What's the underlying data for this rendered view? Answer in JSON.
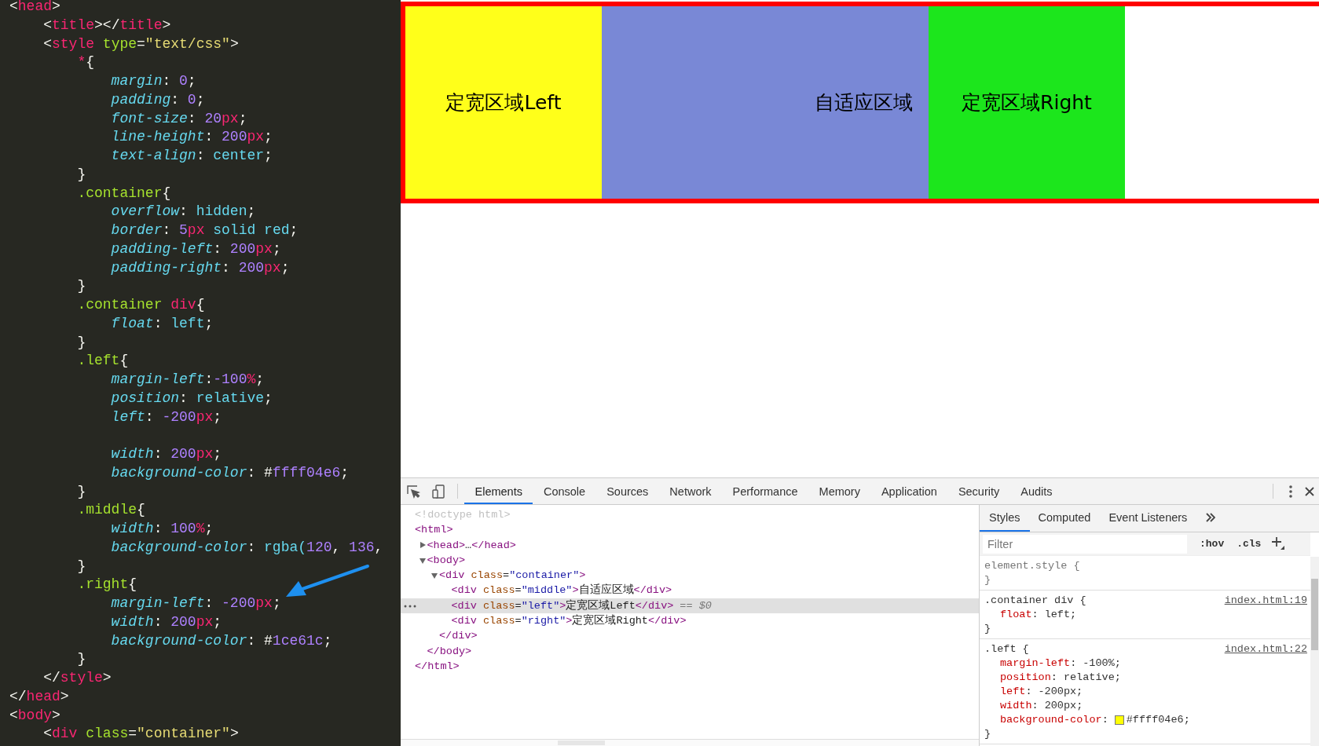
{
  "editor": {
    "lines": [
      {
        "tokens": [
          {
            "kind": "punct",
            "text": "<"
          },
          {
            "kind": "tag",
            "text": "head"
          },
          {
            "kind": "punct",
            "text": ">"
          }
        ]
      },
      {
        "tokens": [
          {
            "kind": "punct",
            "text": "    <"
          },
          {
            "kind": "tag",
            "text": "title"
          },
          {
            "kind": "punct",
            "text": "></"
          },
          {
            "kind": "tag",
            "text": "title"
          },
          {
            "kind": "punct",
            "text": ">"
          }
        ]
      },
      {
        "tokens": [
          {
            "kind": "punct",
            "text": "    <"
          },
          {
            "kind": "tag",
            "text": "style"
          },
          {
            "kind": "attr",
            "text": " type"
          },
          {
            "kind": "punct",
            "text": "="
          },
          {
            "kind": "string",
            "text": "\"text/css\""
          },
          {
            "kind": "punct",
            "text": ">"
          }
        ]
      },
      {
        "tokens": [
          {
            "kind": "tag",
            "text": "        *"
          },
          {
            "kind": "punct",
            "text": "{"
          }
        ]
      },
      {
        "tokens": [
          {
            "kind": "property",
            "text": "            margin"
          },
          {
            "kind": "punct",
            "text": ": "
          },
          {
            "kind": "number",
            "text": "0"
          },
          {
            "kind": "punct",
            "text": ";"
          }
        ]
      },
      {
        "tokens": [
          {
            "kind": "property",
            "text": "            padding"
          },
          {
            "kind": "punct",
            "text": ": "
          },
          {
            "kind": "number",
            "text": "0"
          },
          {
            "kind": "punct",
            "text": ";"
          }
        ]
      },
      {
        "tokens": [
          {
            "kind": "property",
            "text": "            font-size"
          },
          {
            "kind": "punct",
            "text": ": "
          },
          {
            "kind": "number",
            "text": "20"
          },
          {
            "kind": "unit",
            "text": "px"
          },
          {
            "kind": "punct",
            "text": ";"
          }
        ]
      },
      {
        "tokens": [
          {
            "kind": "property",
            "text": "            line-height"
          },
          {
            "kind": "punct",
            "text": ": "
          },
          {
            "kind": "number",
            "text": "200"
          },
          {
            "kind": "unit",
            "text": "px"
          },
          {
            "kind": "punct",
            "text": ";"
          }
        ]
      },
      {
        "tokens": [
          {
            "kind": "property",
            "text": "            text-align"
          },
          {
            "kind": "punct",
            "text": ": "
          },
          {
            "kind": "value",
            "text": "center"
          },
          {
            "kind": "punct",
            "text": ";"
          }
        ]
      },
      {
        "tokens": [
          {
            "kind": "punct",
            "text": "        }"
          }
        ]
      },
      {
        "tokens": [
          {
            "kind": "selector",
            "text": "        .container"
          },
          {
            "kind": "punct",
            "text": "{"
          }
        ]
      },
      {
        "tokens": [
          {
            "kind": "property",
            "text": "            overflow"
          },
          {
            "kind": "punct",
            "text": ": "
          },
          {
            "kind": "value",
            "text": "hidden"
          },
          {
            "kind": "punct",
            "text": ";"
          }
        ]
      },
      {
        "tokens": [
          {
            "kind": "property",
            "text": "            border"
          },
          {
            "kind": "punct",
            "text": ": "
          },
          {
            "kind": "number",
            "text": "5"
          },
          {
            "kind": "unit",
            "text": "px"
          },
          {
            "kind": "value",
            "text": " solid red"
          },
          {
            "kind": "punct",
            "text": ";"
          }
        ]
      },
      {
        "tokens": [
          {
            "kind": "property",
            "text": "            padding-left"
          },
          {
            "kind": "punct",
            "text": ": "
          },
          {
            "kind": "number",
            "text": "200"
          },
          {
            "kind": "unit",
            "text": "px"
          },
          {
            "kind": "punct",
            "text": ";"
          }
        ]
      },
      {
        "tokens": [
          {
            "kind": "property",
            "text": "            padding-right"
          },
          {
            "kind": "punct",
            "text": ": "
          },
          {
            "kind": "number",
            "text": "200"
          },
          {
            "kind": "unit",
            "text": "px"
          },
          {
            "kind": "punct",
            "text": ";"
          }
        ]
      },
      {
        "tokens": [
          {
            "kind": "punct",
            "text": "        }"
          }
        ]
      },
      {
        "tokens": [
          {
            "kind": "selector",
            "text": "        .container"
          },
          {
            "kind": "tag",
            "text": " div"
          },
          {
            "kind": "punct",
            "text": "{"
          }
        ]
      },
      {
        "tokens": [
          {
            "kind": "property",
            "text": "            float"
          },
          {
            "kind": "punct",
            "text": ": "
          },
          {
            "kind": "value",
            "text": "left"
          },
          {
            "kind": "punct",
            "text": ";"
          }
        ]
      },
      {
        "tokens": [
          {
            "kind": "punct",
            "text": "        }"
          }
        ]
      },
      {
        "tokens": [
          {
            "kind": "selector",
            "text": "        .left"
          },
          {
            "kind": "punct",
            "text": "{"
          }
        ]
      },
      {
        "tokens": [
          {
            "kind": "property",
            "text": "            margin-left"
          },
          {
            "kind": "punct",
            "text": ":"
          },
          {
            "kind": "number",
            "text": "-100"
          },
          {
            "kind": "unit",
            "text": "%"
          },
          {
            "kind": "punct",
            "text": ";"
          }
        ]
      },
      {
        "tokens": [
          {
            "kind": "property",
            "text": "            position"
          },
          {
            "kind": "punct",
            "text": ": "
          },
          {
            "kind": "value",
            "text": "relative"
          },
          {
            "kind": "punct",
            "text": ";"
          }
        ]
      },
      {
        "tokens": [
          {
            "kind": "property",
            "text": "            left"
          },
          {
            "kind": "punct",
            "text": ": "
          },
          {
            "kind": "number",
            "text": "-200"
          },
          {
            "kind": "unit",
            "text": "px"
          },
          {
            "kind": "punct",
            "text": ";"
          }
        ],
        "blank_line_after": true
      },
      {
        "tokens": [
          {
            "kind": "property",
            "text": "            width"
          },
          {
            "kind": "punct",
            "text": ": "
          },
          {
            "kind": "number",
            "text": "200"
          },
          {
            "kind": "unit",
            "text": "px"
          },
          {
            "kind": "punct",
            "text": ";"
          }
        ]
      },
      {
        "tokens": [
          {
            "kind": "property",
            "text": "            background-color"
          },
          {
            "kind": "punct",
            "text": ": #"
          },
          {
            "kind": "number",
            "text": "ffff04e6"
          },
          {
            "kind": "punct",
            "text": ";"
          }
        ]
      },
      {
        "tokens": [
          {
            "kind": "punct",
            "text": "        }"
          }
        ]
      },
      {
        "tokens": [
          {
            "kind": "selector",
            "text": "        .middle"
          },
          {
            "kind": "punct",
            "text": "{"
          }
        ]
      },
      {
        "tokens": [
          {
            "kind": "property",
            "text": "            width"
          },
          {
            "kind": "punct",
            "text": ": "
          },
          {
            "kind": "number",
            "text": "100"
          },
          {
            "kind": "unit",
            "text": "%"
          },
          {
            "kind": "punct",
            "text": ";"
          }
        ]
      },
      {
        "tokens": [
          {
            "kind": "property",
            "text": "            background-color"
          },
          {
            "kind": "punct",
            "text": ": "
          },
          {
            "kind": "value",
            "text": "rgba("
          },
          {
            "kind": "number",
            "text": "120"
          },
          {
            "kind": "punct",
            "text": ", "
          },
          {
            "kind": "number",
            "text": "136"
          },
          {
            "kind": "punct",
            "text": ","
          }
        ]
      },
      {
        "tokens": [
          {
            "kind": "punct",
            "text": "        }"
          }
        ]
      },
      {
        "tokens": [
          {
            "kind": "selector",
            "text": "        .right"
          },
          {
            "kind": "punct",
            "text": "{"
          }
        ]
      },
      {
        "tokens": [
          {
            "kind": "property",
            "text": "            margin-left"
          },
          {
            "kind": "punct",
            "text": ": "
          },
          {
            "kind": "number",
            "text": "-200"
          },
          {
            "kind": "unit",
            "text": "px"
          },
          {
            "kind": "punct",
            "text": ";"
          }
        ]
      },
      {
        "tokens": [
          {
            "kind": "property",
            "text": "            width"
          },
          {
            "kind": "punct",
            "text": ": "
          },
          {
            "kind": "number",
            "text": "200"
          },
          {
            "kind": "unit",
            "text": "px"
          },
          {
            "kind": "punct",
            "text": ";"
          }
        ]
      },
      {
        "tokens": [
          {
            "kind": "property",
            "text": "            background-color"
          },
          {
            "kind": "punct",
            "text": ": #"
          },
          {
            "kind": "number",
            "text": "1ce61c"
          },
          {
            "kind": "punct",
            "text": ";"
          }
        ]
      },
      {
        "tokens": [
          {
            "kind": "punct",
            "text": "        }"
          }
        ]
      },
      {
        "tokens": [
          {
            "kind": "punct",
            "text": "    </"
          },
          {
            "kind": "tag",
            "text": "style"
          },
          {
            "kind": "punct",
            "text": ">"
          }
        ]
      },
      {
        "tokens": [
          {
            "kind": "punct",
            "text": "</"
          },
          {
            "kind": "tag",
            "text": "head"
          },
          {
            "kind": "punct",
            "text": ">"
          }
        ]
      },
      {
        "tokens": [
          {
            "kind": "punct",
            "text": "<"
          },
          {
            "kind": "tag",
            "text": "body"
          },
          {
            "kind": "punct",
            "text": ">"
          }
        ]
      },
      {
        "tokens": [
          {
            "kind": "punct",
            "text": "    <"
          },
          {
            "kind": "tag",
            "text": "div"
          },
          {
            "kind": "attr",
            "text": " class"
          },
          {
            "kind": "punct",
            "text": "="
          },
          {
            "kind": "string",
            "text": "\"container\""
          },
          {
            "kind": "punct",
            "text": ">"
          }
        ]
      }
    ]
  },
  "preview": {
    "blocks": [
      {
        "kind": "fixed",
        "text": "定宽区域Left",
        "color": "#ffff1a"
      },
      {
        "kind": "fluid",
        "text": "自适应区域",
        "color": "#7988d6"
      },
      {
        "kind": "fixed",
        "text": "定宽区域Right",
        "color": "#1ce61c"
      }
    ]
  },
  "devtools": {
    "tabs": [
      {
        "label": "Elements",
        "selected": true
      },
      {
        "label": "Console",
        "selected": false
      },
      {
        "label": "Sources",
        "selected": false
      },
      {
        "label": "Network",
        "selected": false
      },
      {
        "label": "Performance",
        "selected": false
      },
      {
        "label": "Memory",
        "selected": false
      },
      {
        "label": "Application",
        "selected": false
      },
      {
        "label": "Security",
        "selected": false
      },
      {
        "label": "Audits",
        "selected": false
      }
    ],
    "dom_tree": [
      {
        "tokens": [
          {
            "kind": "doctype",
            "text": "<!doctype html>"
          }
        ],
        "selected": false
      },
      {
        "tokens": [
          {
            "kind": "tag",
            "text": "<html>"
          }
        ],
        "selected": false,
        "children": [
          {
            "tokens": [
              {
                "kind": "tag",
                "text": "<head>"
              },
              {
                "kind": "text",
                "text": "…"
              },
              {
                "kind": "tag",
                "text": "</head>"
              }
            ],
            "expanded": false,
            "selected": false
          },
          {
            "tokens": [
              {
                "kind": "tag",
                "text": "<body>"
              }
            ],
            "expanded": true,
            "selected": false,
            "children": [
              {
                "tokens": [
                  {
                    "kind": "tag",
                    "text": "<div"
                  },
                  {
                    "kind": "attr",
                    "text": " class"
                  },
                  {
                    "kind": "text",
                    "text": "="
                  },
                  {
                    "kind": "val",
                    "text": "\"container\""
                  },
                  {
                    "kind": "tag",
                    "text": ">"
                  }
                ],
                "expanded": true,
                "selected": false,
                "children": [
                  {
                    "tokens": [
                      {
                        "kind": "tag",
                        "text": "<div"
                      },
                      {
                        "kind": "attr",
                        "text": " class"
                      },
                      {
                        "kind": "text",
                        "text": "="
                      },
                      {
                        "kind": "val",
                        "text": "\"middle\""
                      },
                      {
                        "kind": "tag",
                        "text": ">"
                      },
                      {
                        "kind": "text",
                        "text": "自适应区域"
                      },
                      {
                        "kind": "tag",
                        "text": "</div>"
                      }
                    ],
                    "selected": false
                  },
                  {
                    "tokens": [
                      {
                        "kind": "tag",
                        "text": "<div"
                      },
                      {
                        "kind": "attr",
                        "text": " class"
                      },
                      {
                        "kind": "text",
                        "text": "="
                      },
                      {
                        "kind": "val",
                        "text": "\"left\""
                      },
                      {
                        "kind": "tag",
                        "text": ">"
                      },
                      {
                        "kind": "text",
                        "text": "定宽区域Left"
                      },
                      {
                        "kind": "tag",
                        "text": "</div>"
                      }
                    ],
                    "selected": true,
                    "ref": "== $0"
                  },
                  {
                    "tokens": [
                      {
                        "kind": "tag",
                        "text": "<div"
                      },
                      {
                        "kind": "attr",
                        "text": " class"
                      },
                      {
                        "kind": "text",
                        "text": "="
                      },
                      {
                        "kind": "val",
                        "text": "\"right\""
                      },
                      {
                        "kind": "tag",
                        "text": ">"
                      },
                      {
                        "kind": "text",
                        "text": "定宽区域Right"
                      },
                      {
                        "kind": "tag",
                        "text": "</div>"
                      }
                    ],
                    "selected": false
                  }
                ],
                "closing": [
                  {
                    "kind": "tag",
                    "text": "</div>"
                  }
                ]
              }
            ],
            "closing": [
              {
                "kind": "tag",
                "text": "</body>"
              }
            ]
          }
        ],
        "closing": [
          {
            "kind": "tag",
            "text": "</html>"
          }
        ]
      }
    ],
    "styles_panel": {
      "tabs": [
        {
          "label": "Styles",
          "selected": true
        },
        {
          "label": "Computed",
          "selected": false
        },
        {
          "label": "Event Listeners",
          "selected": false
        }
      ],
      "filter": {
        "placeholder": "Filter"
      },
      "toggles": [
        ":hov",
        ".cls"
      ],
      "rules": [
        {
          "selector": "element.style {",
          "closing": "}",
          "kind": "inline"
        },
        {
          "selector": ".container div {",
          "source": "index.html:19",
          "closing": "}",
          "declarations": [
            {
              "property": "float",
              "colon": ":",
              "value": "left;"
            }
          ]
        },
        {
          "selector": ".left {",
          "source": "index.html:22",
          "closing": "}",
          "declarations": [
            {
              "property": "margin-left",
              "colon": ":",
              "value": "-100%;"
            },
            {
              "property": "position",
              "colon": ":",
              "value": "relative;"
            },
            {
              "property": "left",
              "colon": ":",
              "value": "-200px;"
            },
            {
              "property": "width",
              "colon": ":",
              "value": "200px;"
            },
            {
              "property": "background-color",
              "colon": ":",
              "value": "#ffff04e6;",
              "color": "#ffff04"
            }
          ]
        }
      ]
    }
  }
}
